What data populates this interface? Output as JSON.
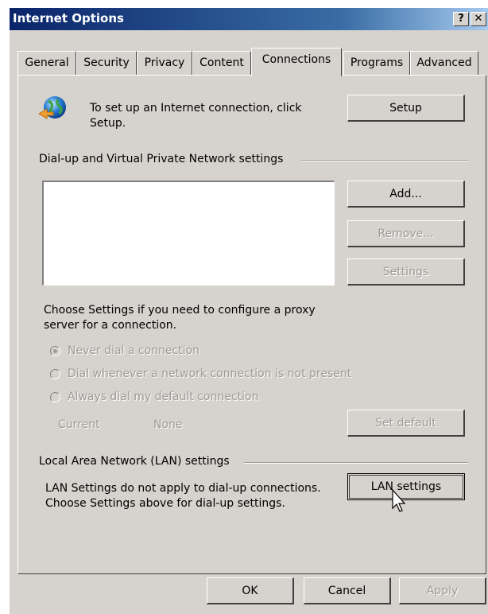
{
  "window": {
    "title": "Internet Options",
    "help_label": "?",
    "close_label": "✕"
  },
  "tabs": [
    {
      "label": "General",
      "active": false
    },
    {
      "label": "Security",
      "active": false
    },
    {
      "label": "Privacy",
      "active": false
    },
    {
      "label": "Content",
      "active": false
    },
    {
      "label": "Connections",
      "active": true
    },
    {
      "label": "Programs",
      "active": false
    },
    {
      "label": "Advanced",
      "active": false
    }
  ],
  "setup": {
    "text": "To set up an Internet connection, click Setup.",
    "button": "Setup"
  },
  "dialup": {
    "heading": "Dial-up and Virtual Private Network settings",
    "add": "Add...",
    "remove": "Remove...",
    "settings": "Settings",
    "proxy_text": "Choose Settings if you need to configure a proxy server for a connection.",
    "radio_never": "Never dial a connection",
    "radio_whenever": "Dial whenever a network connection is not present",
    "radio_always": "Always dial my default connection",
    "current_label": "Current",
    "current_value": "None",
    "set_default": "Set default"
  },
  "lan": {
    "heading": "Local Area Network (LAN) settings",
    "text": "LAN Settings do not apply to dial-up connections. Choose Settings above for dial-up settings.",
    "button": "LAN settings"
  },
  "footer": {
    "ok": "OK",
    "cancel": "Cancel",
    "apply": "Apply"
  }
}
